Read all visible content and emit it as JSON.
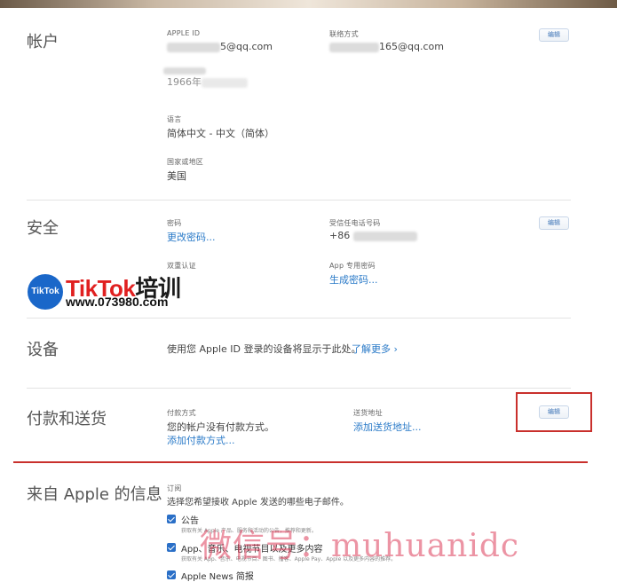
{
  "account": {
    "title": "帐户",
    "apple_id_label": "APPLE ID",
    "apple_id_value": "5@qq.com",
    "contact_label": "联络方式",
    "contact_value": "165@qq.com",
    "birthday_value": "1966年",
    "language_label": "语言",
    "language_value": "简体中文 - 中文（简体）",
    "region_label": "国家或地区",
    "region_value": "美国",
    "edit_label": "编辑"
  },
  "security": {
    "title": "安全",
    "password_label": "密码",
    "change_password_link": "更改密码...",
    "trusted_phone_label": "受信任电话号码",
    "phone_prefix": "+86",
    "two_factor_label": "双重认证",
    "app_password_label": "App 专用密码",
    "generate_password_link": "生成密码...",
    "edit_label": "编辑"
  },
  "devices": {
    "title": "设备",
    "description": "使用您 Apple ID 登录的设备将显示于此处。",
    "learn_more_link": "了解更多 ›"
  },
  "payment": {
    "title": "付款和送货",
    "method_label": "付款方式",
    "method_value": "您的帐户没有付款方式。",
    "add_method_link": "添加付款方式...",
    "shipping_label": "送货地址",
    "add_shipping_link": "添加送货地址...",
    "edit_label": "编辑"
  },
  "apple_info": {
    "title": "来自 Apple 的信息",
    "subscription_label": "订阅",
    "subscription_desc": "选择您希望接收 Apple 发送的哪些电子邮件。",
    "items": [
      {
        "label": "公告",
        "desc": "获取有关 Apple 产品、服务和活动的公告，推荐和更新。"
      },
      {
        "label": "App、音乐、电视节目以及更多内容",
        "desc": "获取有关 App、音乐、电视节目、图书、播客、Apple Pay、Apple 以及更多内容的推荐。"
      },
      {
        "label": "Apple News 简报",
        "desc": ""
      }
    ]
  },
  "watermarks": {
    "tiktok_badge": "TikTok",
    "tiktok_title_latin": "TikTok",
    "tiktok_title_cn": "培训",
    "tiktok_url": "www.073980.com",
    "wechat": "微信号：muhuanidc"
  }
}
